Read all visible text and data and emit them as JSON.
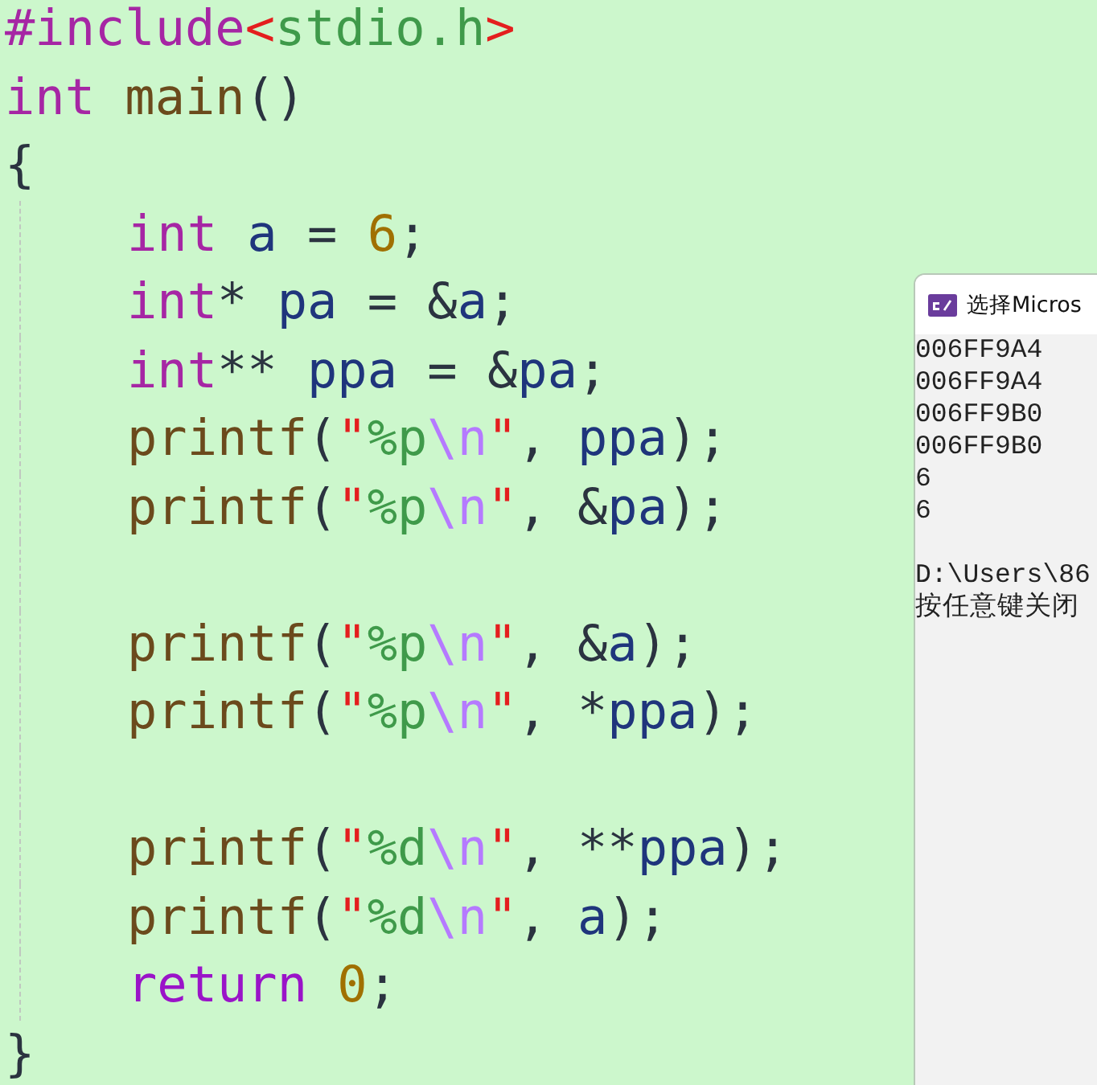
{
  "editor": {
    "lines": [
      {
        "kind": "code",
        "indented": false,
        "tokens": [
          {
            "kind": "directive",
            "text": "#include"
          },
          {
            "kind": "bracket",
            "text": "<"
          },
          {
            "kind": "header",
            "text": "stdio.h"
          },
          {
            "kind": "bracket",
            "text": ">"
          }
        ]
      },
      {
        "kind": "code",
        "indented": false,
        "tokens": [
          {
            "kind": "keyword",
            "text": "int "
          },
          {
            "kind": "function",
            "text": "main"
          },
          {
            "kind": "plain",
            "text": "()"
          }
        ]
      },
      {
        "kind": "code",
        "indented": false,
        "tokens": [
          {
            "kind": "plain",
            "text": "{"
          }
        ]
      },
      {
        "kind": "code",
        "indented": true,
        "tokens": [
          {
            "kind": "keyword",
            "text": "int "
          },
          {
            "kind": "identifier",
            "text": "a"
          },
          {
            "kind": "plain",
            "text": " = "
          },
          {
            "kind": "number",
            "text": "6"
          },
          {
            "kind": "plain",
            "text": ";"
          }
        ]
      },
      {
        "kind": "code",
        "indented": true,
        "tokens": [
          {
            "kind": "keyword",
            "text": "int"
          },
          {
            "kind": "plain",
            "text": "* "
          },
          {
            "kind": "identifier",
            "text": "pa"
          },
          {
            "kind": "plain",
            "text": " = &"
          },
          {
            "kind": "identifier",
            "text": "a"
          },
          {
            "kind": "plain",
            "text": ";"
          }
        ]
      },
      {
        "kind": "code",
        "indented": true,
        "tokens": [
          {
            "kind": "keyword",
            "text": "int"
          },
          {
            "kind": "plain",
            "text": "** "
          },
          {
            "kind": "identifier",
            "text": "ppa"
          },
          {
            "kind": "plain",
            "text": " = &"
          },
          {
            "kind": "identifier",
            "text": "pa"
          },
          {
            "kind": "plain",
            "text": ";"
          }
        ]
      },
      {
        "kind": "code",
        "indented": true,
        "tokens": [
          {
            "kind": "function",
            "text": "printf"
          },
          {
            "kind": "plain",
            "text": "("
          },
          {
            "kind": "quote",
            "text": "\""
          },
          {
            "kind": "string",
            "text": "%p"
          },
          {
            "kind": "escape",
            "text": "\\n"
          },
          {
            "kind": "quote",
            "text": "\""
          },
          {
            "kind": "plain",
            "text": ", "
          },
          {
            "kind": "identifier",
            "text": "ppa"
          },
          {
            "kind": "plain",
            "text": ");"
          }
        ]
      },
      {
        "kind": "code",
        "indented": true,
        "tokens": [
          {
            "kind": "function",
            "text": "printf"
          },
          {
            "kind": "plain",
            "text": "("
          },
          {
            "kind": "quote",
            "text": "\""
          },
          {
            "kind": "string",
            "text": "%p"
          },
          {
            "kind": "escape",
            "text": "\\n"
          },
          {
            "kind": "quote",
            "text": "\""
          },
          {
            "kind": "plain",
            "text": ", &"
          },
          {
            "kind": "identifier",
            "text": "pa"
          },
          {
            "kind": "plain",
            "text": ");"
          }
        ]
      },
      {
        "kind": "blank",
        "indented": true
      },
      {
        "kind": "code",
        "indented": true,
        "tokens": [
          {
            "kind": "function",
            "text": "printf"
          },
          {
            "kind": "plain",
            "text": "("
          },
          {
            "kind": "quote",
            "text": "\""
          },
          {
            "kind": "string",
            "text": "%p"
          },
          {
            "kind": "escape",
            "text": "\\n"
          },
          {
            "kind": "quote",
            "text": "\""
          },
          {
            "kind": "plain",
            "text": ", &"
          },
          {
            "kind": "identifier",
            "text": "a"
          },
          {
            "kind": "plain",
            "text": ");"
          }
        ]
      },
      {
        "kind": "code",
        "indented": true,
        "tokens": [
          {
            "kind": "function",
            "text": "printf"
          },
          {
            "kind": "plain",
            "text": "("
          },
          {
            "kind": "quote",
            "text": "\""
          },
          {
            "kind": "string",
            "text": "%p"
          },
          {
            "kind": "escape",
            "text": "\\n"
          },
          {
            "kind": "quote",
            "text": "\""
          },
          {
            "kind": "plain",
            "text": ", *"
          },
          {
            "kind": "identifier",
            "text": "ppa"
          },
          {
            "kind": "plain",
            "text": ");"
          }
        ]
      },
      {
        "kind": "blank",
        "indented": true
      },
      {
        "kind": "code",
        "indented": true,
        "tokens": [
          {
            "kind": "function",
            "text": "printf"
          },
          {
            "kind": "plain",
            "text": "("
          },
          {
            "kind": "quote",
            "text": "\""
          },
          {
            "kind": "string",
            "text": "%d"
          },
          {
            "kind": "escape",
            "text": "\\n"
          },
          {
            "kind": "quote",
            "text": "\""
          },
          {
            "kind": "plain",
            "text": ", **"
          },
          {
            "kind": "identifier",
            "text": "ppa"
          },
          {
            "kind": "plain",
            "text": ");"
          }
        ]
      },
      {
        "kind": "code",
        "indented": true,
        "tokens": [
          {
            "kind": "function",
            "text": "printf"
          },
          {
            "kind": "plain",
            "text": "("
          },
          {
            "kind": "quote",
            "text": "\""
          },
          {
            "kind": "string",
            "text": "%d"
          },
          {
            "kind": "escape",
            "text": "\\n"
          },
          {
            "kind": "quote",
            "text": "\""
          },
          {
            "kind": "plain",
            "text": ", "
          },
          {
            "kind": "identifier",
            "text": "a"
          },
          {
            "kind": "plain",
            "text": ");"
          }
        ]
      },
      {
        "kind": "code",
        "indented": true,
        "tokens": [
          {
            "kind": "control",
            "text": "return "
          },
          {
            "kind": "number",
            "text": "0"
          },
          {
            "kind": "plain",
            "text": ";"
          }
        ]
      },
      {
        "kind": "code",
        "indented": false,
        "tokens": [
          {
            "kind": "plain",
            "text": "}"
          }
        ]
      }
    ]
  },
  "console": {
    "title": "选择Micros",
    "lines": [
      {
        "kind": "text",
        "text": "006FF9A4"
      },
      {
        "kind": "text",
        "text": "006FF9A4"
      },
      {
        "kind": "text",
        "text": "006FF9B0"
      },
      {
        "kind": "text",
        "text": "006FF9B0"
      },
      {
        "kind": "text",
        "text": "6"
      },
      {
        "kind": "text",
        "text": "6"
      },
      {
        "kind": "blank"
      },
      {
        "kind": "text",
        "text": "D:\\Users\\86"
      },
      {
        "kind": "text",
        "text": "按任意键关闭"
      }
    ]
  }
}
